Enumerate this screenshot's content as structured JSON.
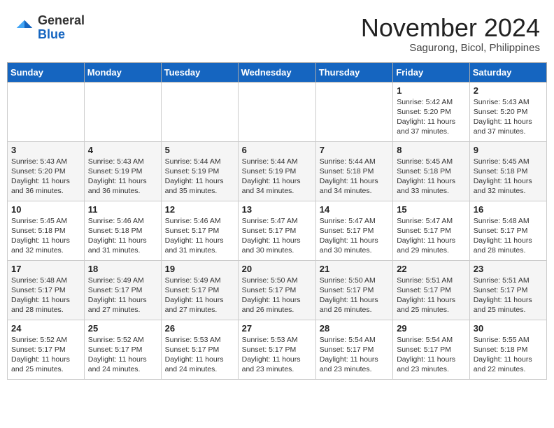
{
  "header": {
    "logo_line1": "General",
    "logo_line2": "Blue",
    "month": "November 2024",
    "location": "Sagurong, Bicol, Philippines"
  },
  "weekdays": [
    "Sunday",
    "Monday",
    "Tuesday",
    "Wednesday",
    "Thursday",
    "Friday",
    "Saturday"
  ],
  "weeks": [
    [
      {
        "day": "",
        "info": ""
      },
      {
        "day": "",
        "info": ""
      },
      {
        "day": "",
        "info": ""
      },
      {
        "day": "",
        "info": ""
      },
      {
        "day": "",
        "info": ""
      },
      {
        "day": "1",
        "info": "Sunrise: 5:42 AM\nSunset: 5:20 PM\nDaylight: 11 hours\nand 37 minutes."
      },
      {
        "day": "2",
        "info": "Sunrise: 5:43 AM\nSunset: 5:20 PM\nDaylight: 11 hours\nand 37 minutes."
      }
    ],
    [
      {
        "day": "3",
        "info": "Sunrise: 5:43 AM\nSunset: 5:20 PM\nDaylight: 11 hours\nand 36 minutes."
      },
      {
        "day": "4",
        "info": "Sunrise: 5:43 AM\nSunset: 5:19 PM\nDaylight: 11 hours\nand 36 minutes."
      },
      {
        "day": "5",
        "info": "Sunrise: 5:44 AM\nSunset: 5:19 PM\nDaylight: 11 hours\nand 35 minutes."
      },
      {
        "day": "6",
        "info": "Sunrise: 5:44 AM\nSunset: 5:19 PM\nDaylight: 11 hours\nand 34 minutes."
      },
      {
        "day": "7",
        "info": "Sunrise: 5:44 AM\nSunset: 5:18 PM\nDaylight: 11 hours\nand 34 minutes."
      },
      {
        "day": "8",
        "info": "Sunrise: 5:45 AM\nSunset: 5:18 PM\nDaylight: 11 hours\nand 33 minutes."
      },
      {
        "day": "9",
        "info": "Sunrise: 5:45 AM\nSunset: 5:18 PM\nDaylight: 11 hours\nand 32 minutes."
      }
    ],
    [
      {
        "day": "10",
        "info": "Sunrise: 5:45 AM\nSunset: 5:18 PM\nDaylight: 11 hours\nand 32 minutes."
      },
      {
        "day": "11",
        "info": "Sunrise: 5:46 AM\nSunset: 5:18 PM\nDaylight: 11 hours\nand 31 minutes."
      },
      {
        "day": "12",
        "info": "Sunrise: 5:46 AM\nSunset: 5:17 PM\nDaylight: 11 hours\nand 31 minutes."
      },
      {
        "day": "13",
        "info": "Sunrise: 5:47 AM\nSunset: 5:17 PM\nDaylight: 11 hours\nand 30 minutes."
      },
      {
        "day": "14",
        "info": "Sunrise: 5:47 AM\nSunset: 5:17 PM\nDaylight: 11 hours\nand 30 minutes."
      },
      {
        "day": "15",
        "info": "Sunrise: 5:47 AM\nSunset: 5:17 PM\nDaylight: 11 hours\nand 29 minutes."
      },
      {
        "day": "16",
        "info": "Sunrise: 5:48 AM\nSunset: 5:17 PM\nDaylight: 11 hours\nand 28 minutes."
      }
    ],
    [
      {
        "day": "17",
        "info": "Sunrise: 5:48 AM\nSunset: 5:17 PM\nDaylight: 11 hours\nand 28 minutes."
      },
      {
        "day": "18",
        "info": "Sunrise: 5:49 AM\nSunset: 5:17 PM\nDaylight: 11 hours\nand 27 minutes."
      },
      {
        "day": "19",
        "info": "Sunrise: 5:49 AM\nSunset: 5:17 PM\nDaylight: 11 hours\nand 27 minutes."
      },
      {
        "day": "20",
        "info": "Sunrise: 5:50 AM\nSunset: 5:17 PM\nDaylight: 11 hours\nand 26 minutes."
      },
      {
        "day": "21",
        "info": "Sunrise: 5:50 AM\nSunset: 5:17 PM\nDaylight: 11 hours\nand 26 minutes."
      },
      {
        "day": "22",
        "info": "Sunrise: 5:51 AM\nSunset: 5:17 PM\nDaylight: 11 hours\nand 25 minutes."
      },
      {
        "day": "23",
        "info": "Sunrise: 5:51 AM\nSunset: 5:17 PM\nDaylight: 11 hours\nand 25 minutes."
      }
    ],
    [
      {
        "day": "24",
        "info": "Sunrise: 5:52 AM\nSunset: 5:17 PM\nDaylight: 11 hours\nand 25 minutes."
      },
      {
        "day": "25",
        "info": "Sunrise: 5:52 AM\nSunset: 5:17 PM\nDaylight: 11 hours\nand 24 minutes."
      },
      {
        "day": "26",
        "info": "Sunrise: 5:53 AM\nSunset: 5:17 PM\nDaylight: 11 hours\nand 24 minutes."
      },
      {
        "day": "27",
        "info": "Sunrise: 5:53 AM\nSunset: 5:17 PM\nDaylight: 11 hours\nand 23 minutes."
      },
      {
        "day": "28",
        "info": "Sunrise: 5:54 AM\nSunset: 5:17 PM\nDaylight: 11 hours\nand 23 minutes."
      },
      {
        "day": "29",
        "info": "Sunrise: 5:54 AM\nSunset: 5:17 PM\nDaylight: 11 hours\nand 23 minutes."
      },
      {
        "day": "30",
        "info": "Sunrise: 5:55 AM\nSunset: 5:18 PM\nDaylight: 11 hours\nand 22 minutes."
      }
    ]
  ]
}
